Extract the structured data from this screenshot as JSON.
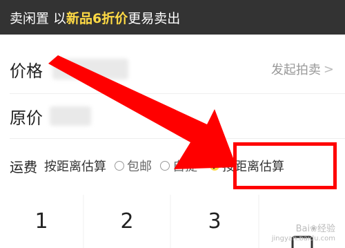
{
  "banner": {
    "prefix": "卖闲置 以",
    "highlight": "新品6折价",
    "suffix": "更易卖出"
  },
  "price": {
    "label": "价格",
    "auction_label": "发起拍卖",
    "auction_chevron": ">"
  },
  "original_price": {
    "label": "原价"
  },
  "shipping": {
    "label": "运费",
    "current": "按距离估算",
    "options": [
      {
        "label": "包邮",
        "selected": false
      },
      {
        "label": "自提",
        "selected": false
      },
      {
        "label": "按距离估算",
        "selected": true
      }
    ]
  },
  "keypad": {
    "keys": [
      "1",
      "2",
      "3"
    ]
  },
  "watermark": {
    "line1": "Bai❀经验",
    "line2": "jingyan.baidu.com"
  },
  "colors": {
    "accent": "#ffda44",
    "annotation": "#ff0000",
    "banner_bg": "#333333"
  }
}
